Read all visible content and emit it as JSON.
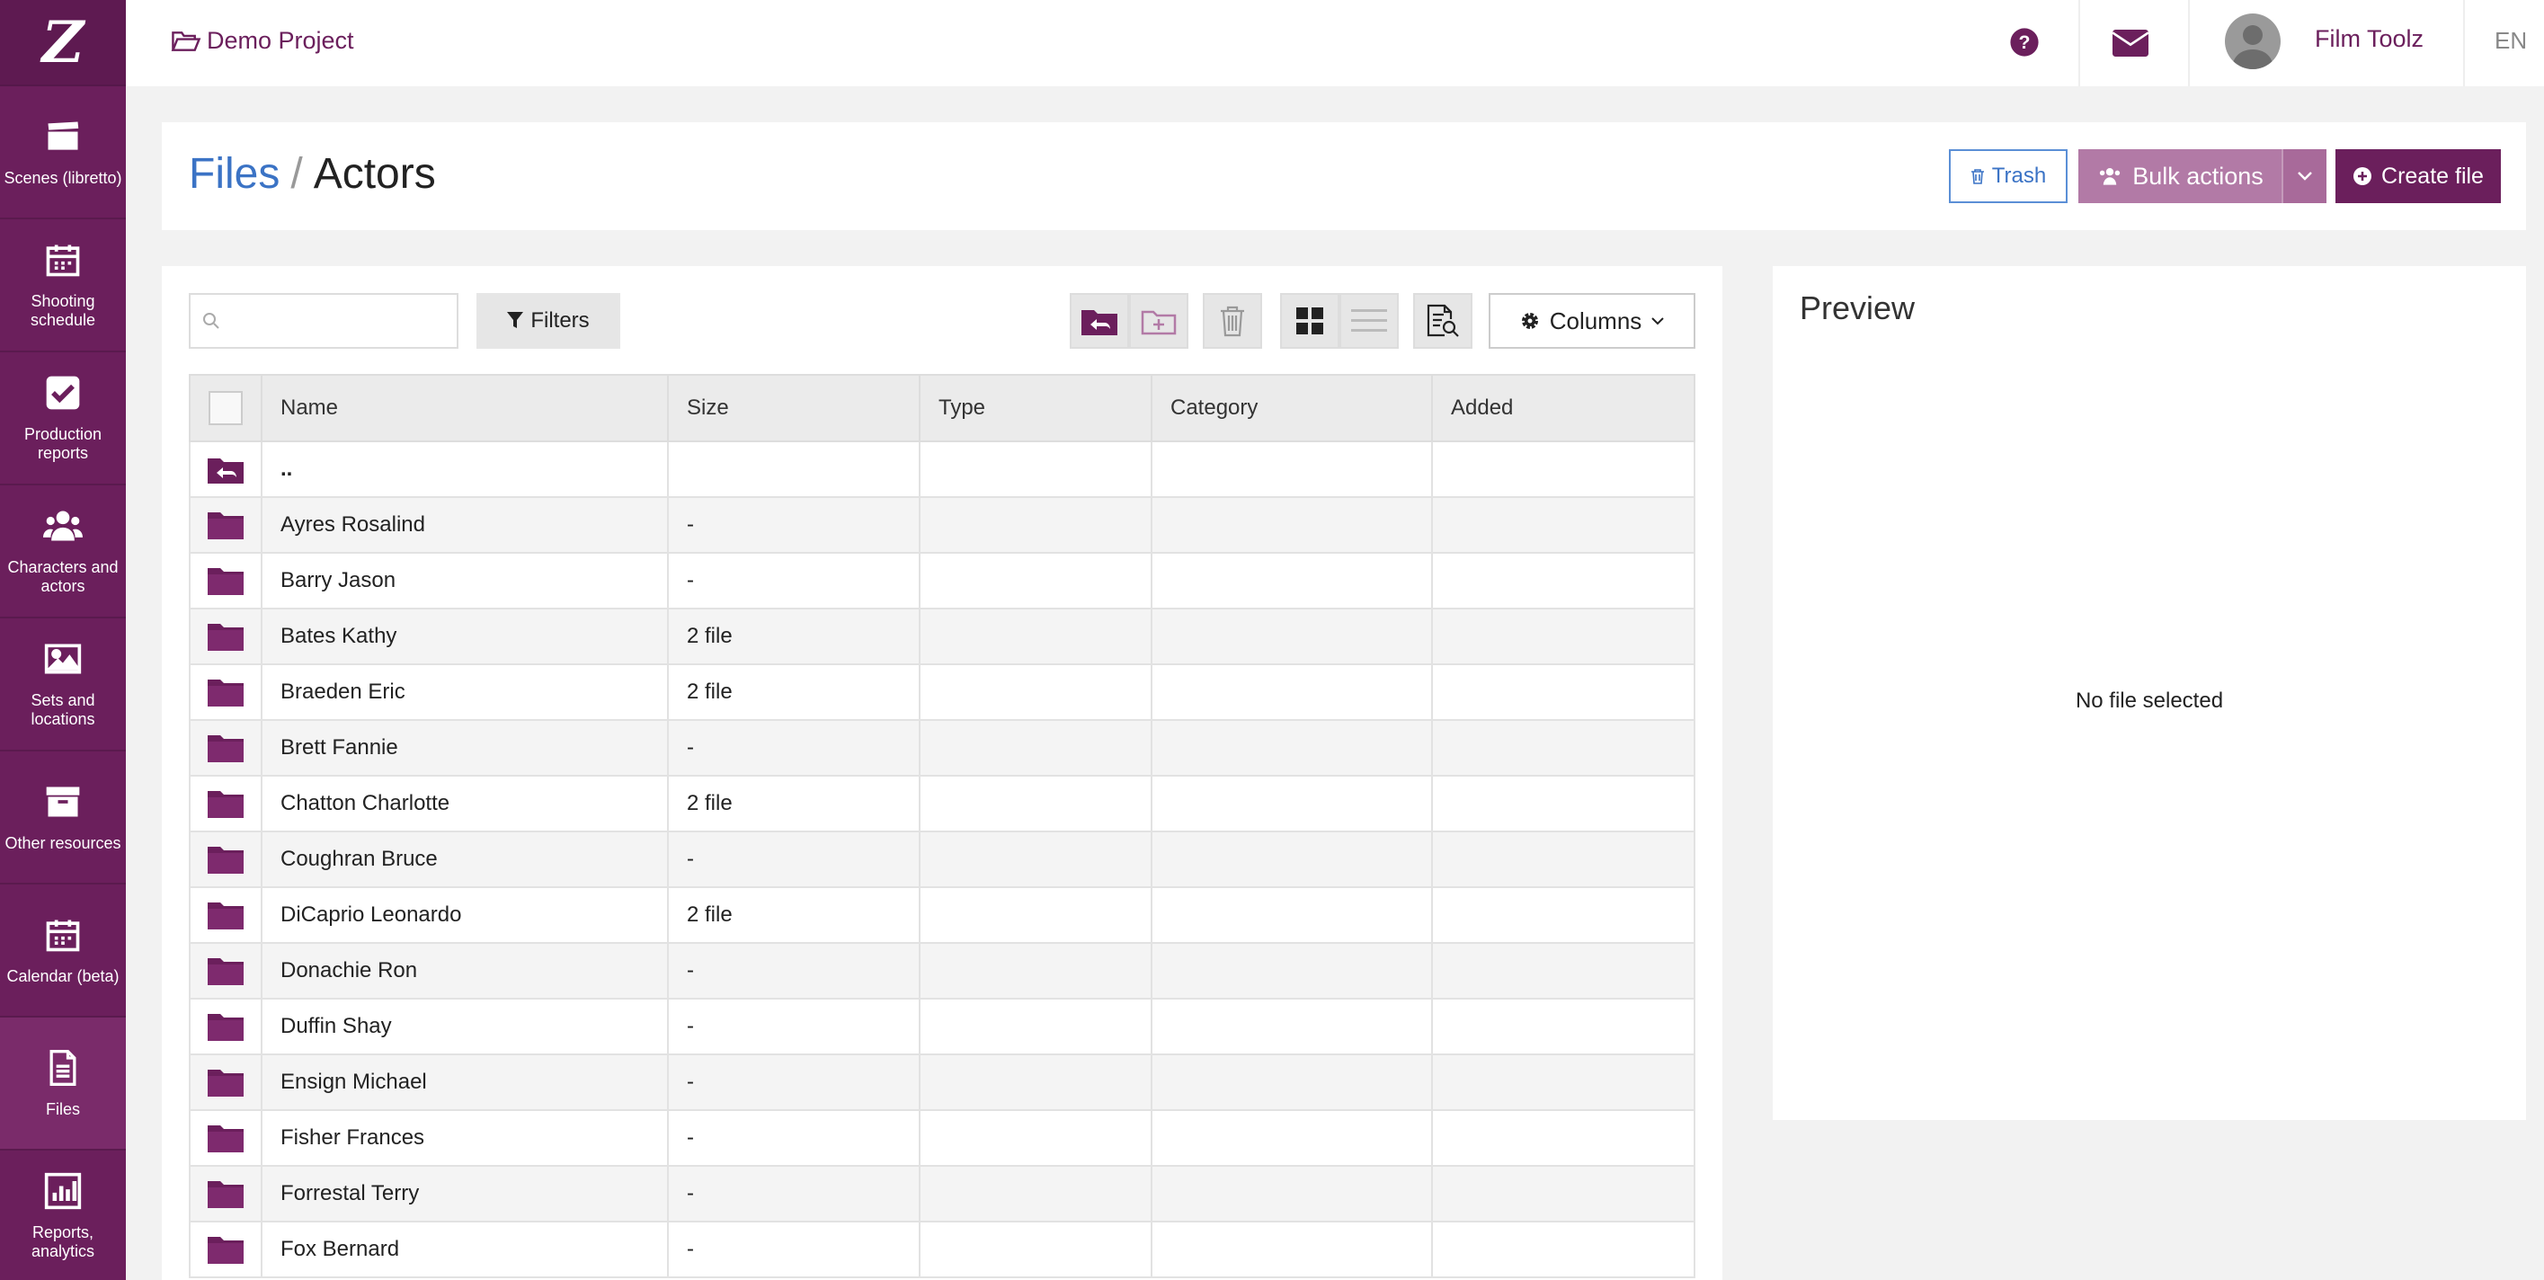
{
  "sidebar": {
    "logo": "Z",
    "items": [
      {
        "label": "Scenes (libretto)",
        "icon": "clapperboard-icon"
      },
      {
        "label": "Shooting schedule",
        "icon": "calendar-icon"
      },
      {
        "label": "Production reports",
        "icon": "checkbox-icon"
      },
      {
        "label": "Characters and actors",
        "icon": "users-icon"
      },
      {
        "label": "Sets and locations",
        "icon": "image-icon"
      },
      {
        "label": "Other resources",
        "icon": "archive-icon"
      },
      {
        "label": "Calendar (beta)",
        "icon": "calendar-icon"
      },
      {
        "label": "Files",
        "icon": "file-icon"
      },
      {
        "label": "Reports, analytics",
        "icon": "bar-chart-icon"
      }
    ]
  },
  "topbar": {
    "project": "Demo Project",
    "user": "Film Toolz",
    "lang": "EN"
  },
  "header": {
    "crumb_root": "Files",
    "crumb_sep": "/",
    "crumb_current": "Actors",
    "trash": "Trash",
    "bulk": "Bulk actions",
    "create": "Create file"
  },
  "toolbar": {
    "search_placeholder": "",
    "filters": "Filters",
    "columns": "Columns"
  },
  "table": {
    "headers": [
      "Name",
      "Size",
      "Type",
      "Category",
      "Added"
    ],
    "up_row": "..",
    "rows": [
      {
        "name": "Ayres Rosalind",
        "size": "-"
      },
      {
        "name": "Barry Jason",
        "size": "-"
      },
      {
        "name": "Bates Kathy",
        "size": "2 file"
      },
      {
        "name": "Braeden Eric",
        "size": "2 file"
      },
      {
        "name": "Brett Fannie",
        "size": "-"
      },
      {
        "name": "Chatton Charlotte",
        "size": "2 file"
      },
      {
        "name": "Coughran Bruce",
        "size": "-"
      },
      {
        "name": "DiCaprio Leonardo",
        "size": "2 file"
      },
      {
        "name": "Donachie Ron",
        "size": "-"
      },
      {
        "name": "Duffin Shay",
        "size": "-"
      },
      {
        "name": "Ensign Michael",
        "size": "-"
      },
      {
        "name": "Fisher Frances",
        "size": "-"
      },
      {
        "name": "Forrestal Terry",
        "size": "-"
      },
      {
        "name": "Fox Bernard",
        "size": "-"
      }
    ]
  },
  "preview": {
    "title": "Preview",
    "empty": "No file selected"
  },
  "colors": {
    "brand": "#6b1f5c",
    "link": "#3b73c5"
  }
}
